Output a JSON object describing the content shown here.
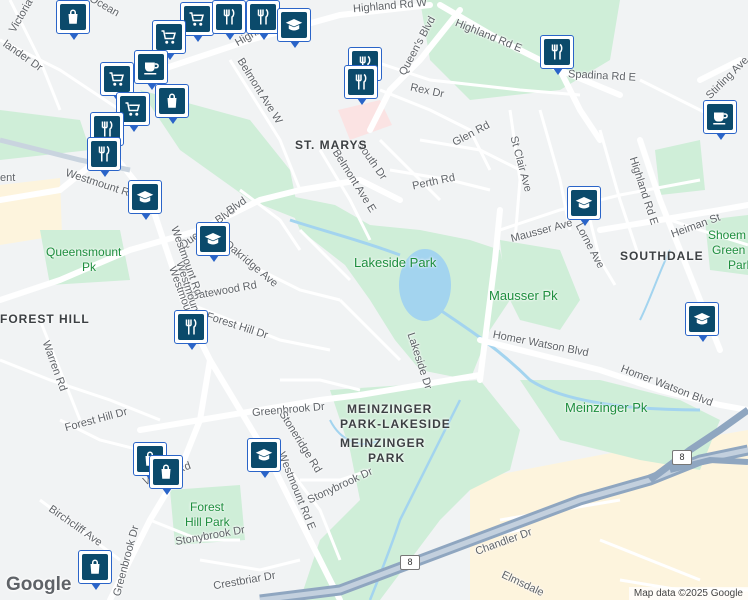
{
  "colors": {
    "background": "#f1f3f4",
    "park": "#cfeed8",
    "water": "#a3d4ef",
    "hospital": "#fbe3e3",
    "industrial": "#fdf4dd",
    "highway": "#8fa6c0",
    "arterial": "#ffffff",
    "pin_border": "#2a64c8",
    "pin_fill": "#0b4a6b"
  },
  "street_labels": [
    "Highland Rd W",
    "Highland Rd E",
    "Spadina Rd E",
    "Rex Dr",
    "Queen's Blvd",
    "Belmont Ave W",
    "Glen Rd",
    "St Clair Ave",
    "South Dr",
    "Perth Rd",
    "Belmont Ave E",
    "Westmount Rd",
    "Mausser Ave",
    "Lorne Ave",
    "Highland Rd E",
    "Heiman St",
    "Stirling Ave",
    "Gatewood Rd",
    "Forest Hill Dr",
    "Warren Rd",
    "Lakeside Dr",
    "Homer Watson Blvd",
    "Homer Watson Blvd",
    "Greenbrook Dr",
    "Forest Hill Dr",
    "Village Rd",
    "Stonybrook Dr",
    "Stonybrook Dr",
    "Birchcliff Ave",
    "Greenbrook Dr",
    "Westmount Rd E",
    "Chandler Dr",
    "Elmsdale",
    "Victoria",
    "Crestbriar Dr",
    "Oakridge Ave",
    "Stoneridge Rd",
    "ent",
    "Westmount Rd",
    "Westmount",
    "Queen's Blvd",
    "Blvd",
    "Highla",
    "Westmount Rd",
    "Ocean",
    "lander Dr"
  ],
  "area_labels": [
    "ST. MARYS",
    "SOUTHDALE",
    "FOREST HILL",
    "MEINZINGER",
    "PARK-LAKESIDE",
    "MEINZINGER",
    "PARK"
  ],
  "park_labels": [
    "Lakeside Park",
    "Mausser Pk",
    "Meinzinger Pk",
    "Queensmount",
    "Pk",
    "Forest",
    "Hill Park",
    "Shoem",
    "Green",
    "Park"
  ],
  "highway_shields": [
    "8",
    "8"
  ],
  "icons": [
    {
      "name": "shopping-bag-icon"
    },
    {
      "name": "shopping-cart-icon"
    },
    {
      "name": "restaurant-icon"
    },
    {
      "name": "school-icon"
    },
    {
      "name": "cafe-icon"
    }
  ],
  "logo": "Google",
  "attribution": "Map data ©2025 Google"
}
